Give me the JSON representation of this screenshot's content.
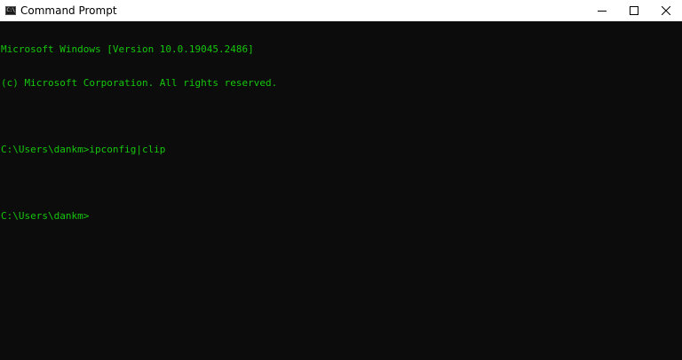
{
  "window": {
    "title": "Command Prompt",
    "app_icon_text": "C:\\",
    "controls": [
      "minimize",
      "maximize",
      "close"
    ]
  },
  "console": {
    "lines": [
      "Microsoft Windows [Version 10.0.19045.2486]",
      "(c) Microsoft Corporation. All rights reserved.",
      "",
      "C:\\Users\\dankm>ipconfig|clip",
      "",
      "C:\\Users\\dankm>"
    ],
    "text_color": "#16c60c",
    "background": "#0c0c0c"
  }
}
